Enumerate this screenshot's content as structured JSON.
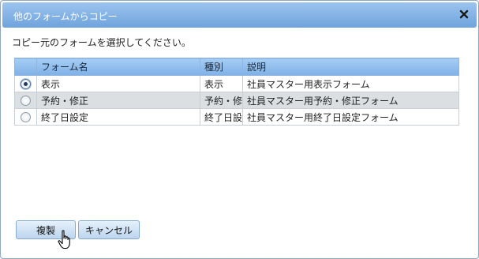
{
  "dialog": {
    "title": "他のフォームからコピー",
    "instruction": "コピー元のフォームを選択してください。"
  },
  "table": {
    "headers": [
      "フォーム名",
      "種別",
      "説明"
    ],
    "rows": [
      {
        "name": "表示",
        "type": "表示",
        "description": "社員マスター用表示フォーム",
        "selected": true
      },
      {
        "name": "予約・修正",
        "type": "予約・修",
        "description": "社員マスター用予約・修正フォーム",
        "selected": false
      },
      {
        "name": "終了日設定",
        "type": "終了日設",
        "description": "社員マスター用終了日設定フォーム",
        "selected": false
      }
    ]
  },
  "buttons": {
    "copy_label": "複製",
    "cancel_label": "キャンセル"
  },
  "icons": {
    "close": "close-icon",
    "cursor": "hand-pointer-icon"
  },
  "colors": {
    "titlebar": "#7fb0e6",
    "header": "#8fb4dd",
    "alt_row": "#dcdfe2"
  }
}
